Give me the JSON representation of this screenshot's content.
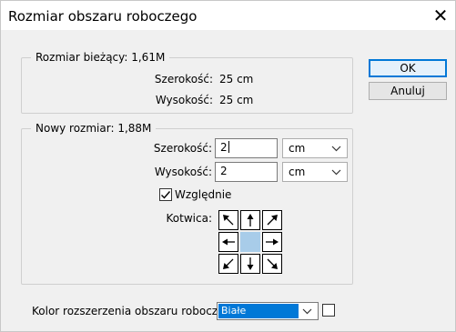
{
  "dialog": {
    "title": "Rozmiar obszaru roboczego",
    "close_glyph": "✕"
  },
  "current_size": {
    "legend": "Rozmiar bieżący: 1,61M",
    "width_label": "Szerokość:",
    "width_value": "25 cm",
    "height_label": "Wysokość:",
    "height_value": "25 cm"
  },
  "new_size": {
    "legend": "Nowy rozmiar: 1,88M",
    "width_label": "Szerokość:",
    "width_value": "2",
    "width_unit": "cm",
    "height_label": "Wysokość:",
    "height_value": "2",
    "height_unit": "cm",
    "relative_label": "Względnie",
    "relative_checked": true,
    "anchor_label": "Kotwica:",
    "anchor_arrows": [
      "arrow-up-left",
      "arrow-up",
      "arrow-up-right",
      "arrow-left",
      "",
      "arrow-right",
      "arrow-down-left",
      "arrow-down",
      "arrow-down-right"
    ]
  },
  "buttons": {
    "ok": "OK",
    "cancel": "Anuluj"
  },
  "extension_color": {
    "label": "Kolor rozszerzenia obszaru roboczego:",
    "selected": "Białe",
    "swatch_color": "#ffffff"
  },
  "colors": {
    "accent": "#0078d7",
    "anchor_center": "#a8cce9"
  }
}
